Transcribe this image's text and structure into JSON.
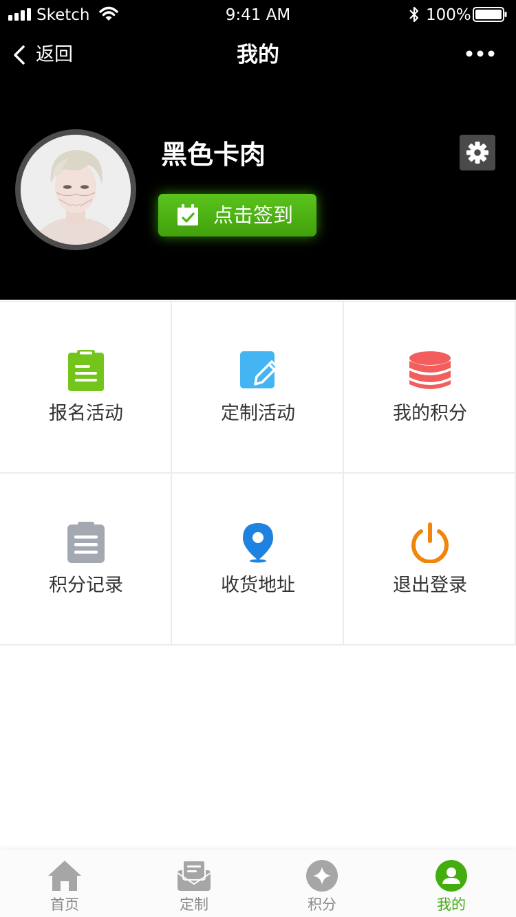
{
  "status_bar": {
    "carrier": "Sketch",
    "time": "9:41 AM",
    "battery": "100%"
  },
  "nav": {
    "back_label": "返回",
    "title": "我的",
    "more_icon": "more-dots-icon"
  },
  "profile": {
    "name": "黑色卡肉",
    "checkin_label": "点击签到",
    "checkin_icon": "calendar-check-icon",
    "settings_icon": "gear-icon"
  },
  "menu": {
    "items": [
      {
        "label": "报名活动",
        "icon": "clipboard-icon",
        "color": "#73c51b"
      },
      {
        "label": "定制活动",
        "icon": "edit-icon",
        "color": "#45b4f3"
      },
      {
        "label": "我的积分",
        "icon": "database-icon",
        "color": "#f25e5e"
      },
      {
        "label": "积分记录",
        "icon": "record-icon",
        "color": "#a4a9b1"
      },
      {
        "label": "收货地址",
        "icon": "location-pin-icon",
        "color": "#1e83e0"
      },
      {
        "label": "退出登录",
        "icon": "power-icon",
        "color": "#f0850b"
      }
    ]
  },
  "tabbar": {
    "items": [
      {
        "label": "首页",
        "icon": "home-icon"
      },
      {
        "label": "定制",
        "icon": "mail-icon"
      },
      {
        "label": "积分",
        "icon": "diamond-icon"
      },
      {
        "label": "我的",
        "icon": "user-icon"
      }
    ],
    "active": "我的",
    "active_color": "#43ad0f",
    "inactive_color": "#8a8a8a"
  }
}
